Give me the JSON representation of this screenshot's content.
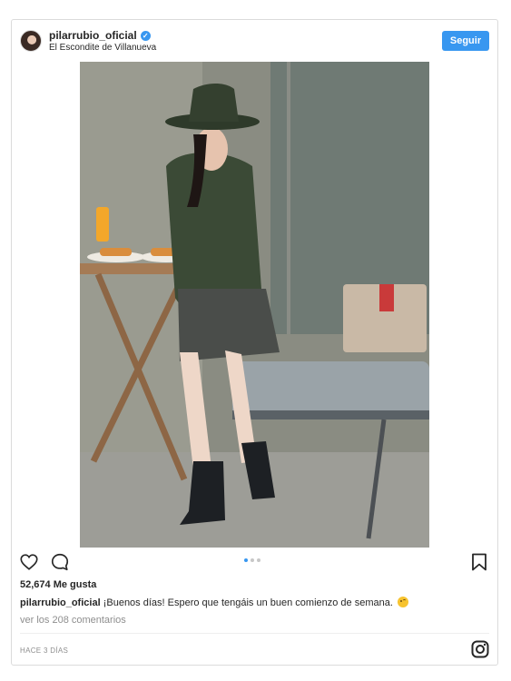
{
  "post": {
    "username": "pilarrubio_oficial",
    "verified": true,
    "location": "El Escondite de Villanueva",
    "follow_label": "Seguir"
  },
  "photo": {
    "carousel_count": 3,
    "active_index": 0
  },
  "engagement": {
    "likes_count": "52,674",
    "likes_label": "Me gusta"
  },
  "caption": {
    "username": "pilarrubio_oficial",
    "text": "¡Buenos días! Espero que tengáis un buen comienzo de semana."
  },
  "comments": {
    "link_text": "ver los 208 comentarios"
  },
  "footer": {
    "timestamp": "HACE 3 DÍAS"
  },
  "colors": {
    "accent": "#3897f0",
    "muted": "#8e8e8e",
    "text": "#262626",
    "border": "#dbdbdb"
  },
  "icons": [
    "verified-icon",
    "tag-people-icon",
    "heart-icon",
    "comment-icon",
    "bookmark-icon",
    "instagram-icon",
    "winking-emoji-icon"
  ]
}
